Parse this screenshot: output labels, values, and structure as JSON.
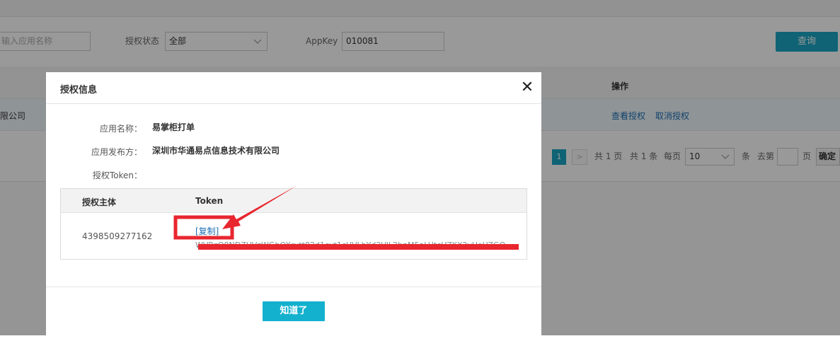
{
  "filters": {
    "app_name_placeholder": "输入应用名称",
    "auth_status_label": "授权状态",
    "auth_status_value": "全部",
    "appkey_label": "AppKey",
    "appkey_value": "010081",
    "query_label": "查询"
  },
  "table": {
    "ops_header": "操作",
    "row": {
      "company_fragment": "限公司",
      "action_view": "查看授权",
      "action_cancel": "取消授权"
    }
  },
  "pager": {
    "current_page": "1",
    "next": ">",
    "total_pages": "共 1 页",
    "total_items": "共 1 条",
    "per_page_label": "每页",
    "per_page_value": "10",
    "per_page_unit": "条",
    "goto_label": "去第",
    "goto_unit": "页",
    "confirm_label": "确定"
  },
  "modal": {
    "title": "授权信息",
    "close_icon": "close-icon",
    "fields": [
      {
        "label": "应用名称：",
        "value": "易掌柜打单"
      },
      {
        "label": "应用发布方：",
        "value": "深圳市华通易点信息技术有限公司"
      },
      {
        "label": "授权Token：",
        "value": ""
      }
    ],
    "token_table": {
      "headers": [
        "授权主体",
        "Token"
      ],
      "rows": [
        {
          "subject": "4398509277162",
          "copy_label": "[复制]",
          "token_partial": "WVRzO8NDZUVzWGbOXrutt82d1cvt1cUVLbYd2VlL2bnM5aLUtcUZKX2vUoUZGO"
        }
      ]
    },
    "ok_label": "知道了"
  },
  "annotation": {
    "highlight_color": "#e8262e"
  }
}
